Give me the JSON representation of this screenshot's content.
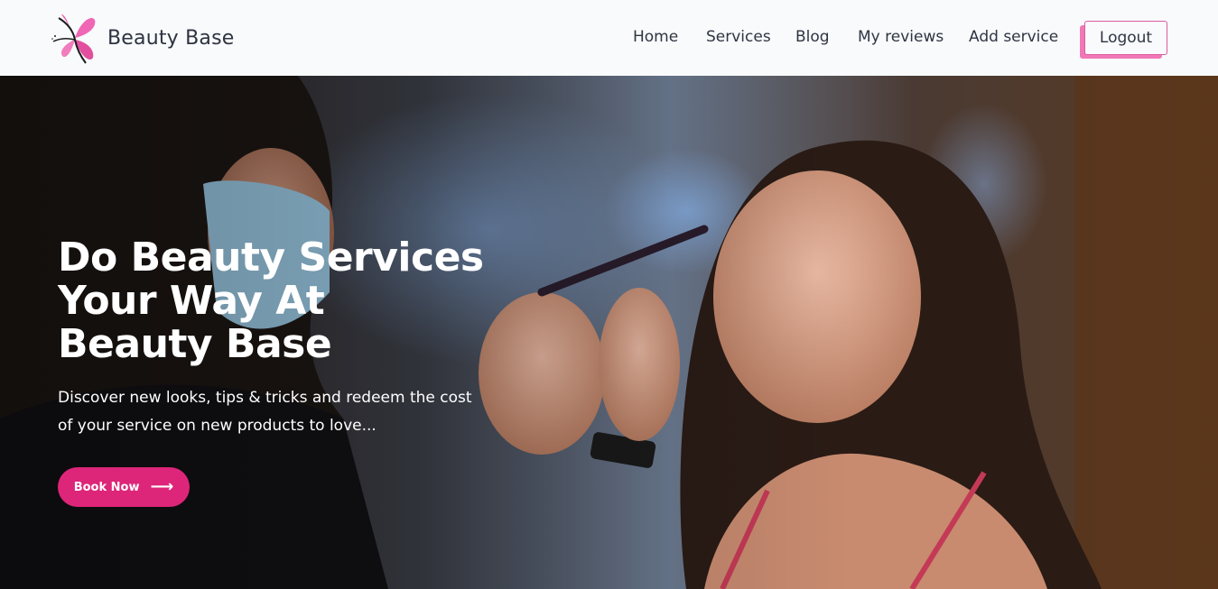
{
  "brand": {
    "name": "Beauty Base",
    "logo_icon": "butterfly-icon"
  },
  "nav": {
    "home": "Home",
    "services": "Services",
    "blog": "Blog",
    "my_reviews": "My reviews",
    "add_service": "Add service",
    "logout": "Logout"
  },
  "hero": {
    "title": "Do Beauty Services Your Way At Beauty Base",
    "subtitle": "Discover new looks, tips & tricks and redeem the cost of your service on new products to love...",
    "cta_label": "Book Now",
    "cta_icon": "arrow-right-icon"
  },
  "colors": {
    "accent": "#dd2579",
    "logout_border": "#e05aa0",
    "logout_shadow": "#f178b6",
    "navbar_bg": "#f8fafc"
  }
}
